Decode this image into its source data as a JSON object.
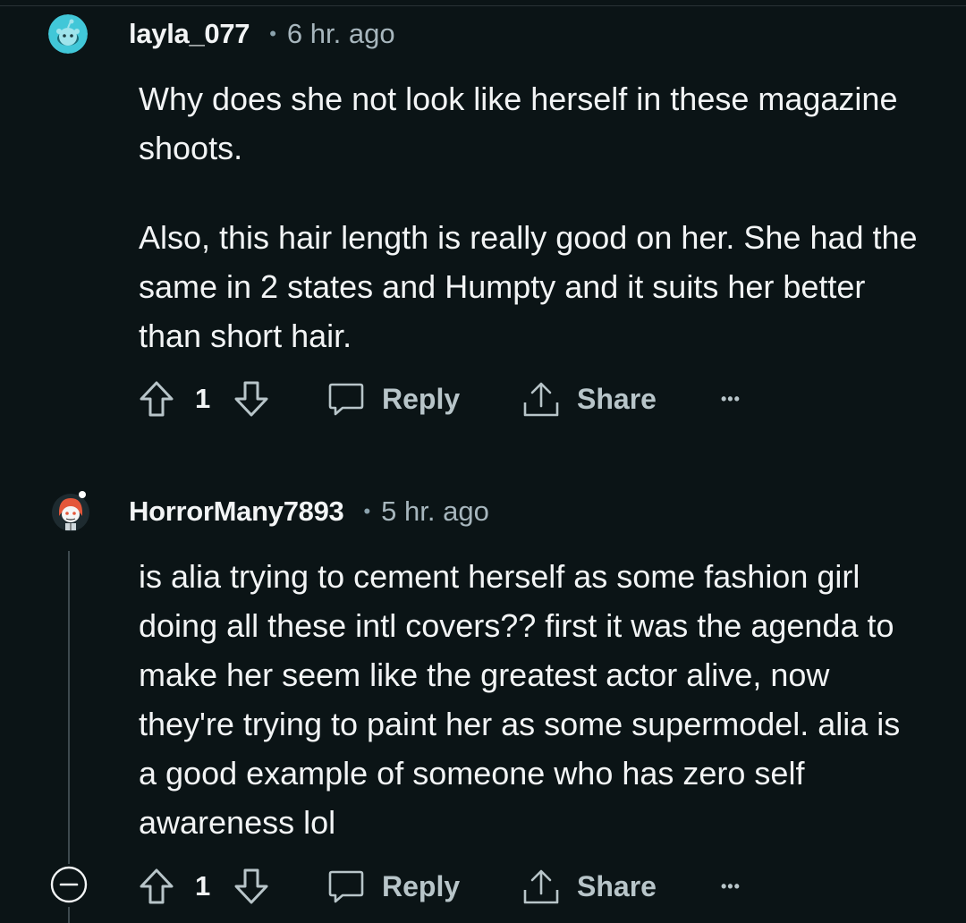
{
  "comments": [
    {
      "username": "layla_077",
      "time": "6 hr. ago",
      "paragraphs": [
        "Why does she not look like herself in these magazine shoots.",
        "Also, this hair length is really good on her. She had the same in 2 states and Humpty and it suits her better than short hair."
      ],
      "votes": "1",
      "reply_label": "Reply",
      "share_label": "Share",
      "avatar_icon": "snoo-avatar-icon"
    },
    {
      "username": "HorrorMany7893",
      "time": "5 hr. ago",
      "paragraphs": [
        "is alia trying to cement herself as some fashion girl doing all these intl covers?? first it was the agenda to make her seem like the greatest actor alive, now they're trying to paint her as some supermodel. alia is a good example of someone who has zero self awareness lol"
      ],
      "votes": "1",
      "reply_label": "Reply",
      "share_label": "Share",
      "avatar_icon": "snoo-red-hair-avatar-icon"
    }
  ],
  "colors": {
    "background": "#0b1416",
    "text": "#f2f4f5",
    "muted": "#a7b6bd",
    "avatar_teal": "#41c7d8"
  },
  "icons": {
    "sep": "•",
    "more": "•••"
  }
}
